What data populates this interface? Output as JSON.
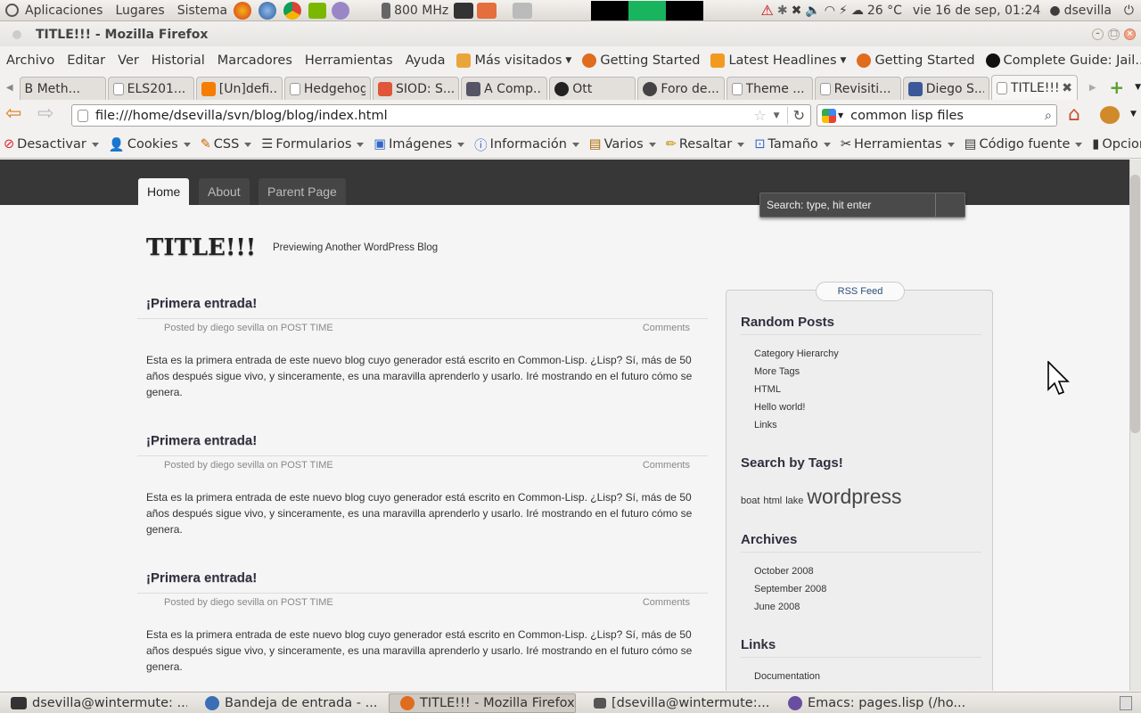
{
  "panel": {
    "menus": [
      "Aplicaciones",
      "Lugares",
      "Sistema"
    ],
    "cpu": "800 MHz",
    "temp": "26 °C",
    "clock": "vie 16 de sep, 01:24",
    "user": "dsevilla"
  },
  "window": {
    "title": "TITLE!!! - Mozilla Firefox"
  },
  "menubar": {
    "items": [
      "Archivo",
      "Editar",
      "Ver",
      "Historial",
      "Marcadores",
      "Herramientas",
      "Ayuda"
    ],
    "bookmarks": [
      "Más visitados",
      "Getting Started",
      "Latest Headlines",
      "Getting Started",
      "Complete Guide: Jail..."
    ]
  },
  "tabs": [
    "B Meth...",
    "ELS201...",
    "[Un]defi...",
    "Hedgehog",
    "SIOD: S...",
    "A Comp...",
    "Ott",
    "Foro de...",
    "Theme ...",
    "Revisiti...",
    "Diego S...",
    "TITLE!!!"
  ],
  "nav": {
    "url": "file:///home/dsevilla/svn/blog/blog/index.html",
    "search": "common lisp files"
  },
  "devbar": [
    "Desactivar",
    "Cookies",
    "CSS",
    "Formularios",
    "Imágenes",
    "Información",
    "Varios",
    "Resaltar",
    "Tamaño",
    "Herramientas",
    "Código fuente",
    "Opcion"
  ],
  "page": {
    "nav_tabs": [
      "Home",
      "About",
      "Parent Page"
    ],
    "search_placeholder": "Search: type, hit enter",
    "title": "TITLE!!!",
    "tagline": "Previewing Another WordPress Blog",
    "posts": [
      {
        "title": "¡Primera entrada!",
        "meta_posted": "Posted by diego sevilla on POST TIME",
        "meta_comments": "Comments",
        "body": "Esta es la primera entrada de este nuevo blog cuyo generador está escrito en Common-Lisp. ¿Lisp? Sí, más de 50 años después sigue vivo, y sinceramente, es una maravilla aprenderlo y usarlo. Iré mostrando en el futuro cómo se genera."
      },
      {
        "title": "¡Primera entrada!",
        "meta_posted": "Posted by diego sevilla on POST TIME",
        "meta_comments": "Comments",
        "body": "Esta es la primera entrada de este nuevo blog cuyo generador está escrito en Common-Lisp. ¿Lisp? Sí, más de 50 años después sigue vivo, y sinceramente, es una maravilla aprenderlo y usarlo. Iré mostrando en el futuro cómo se genera."
      },
      {
        "title": "¡Primera entrada!",
        "meta_posted": "Posted by diego sevilla on POST TIME",
        "meta_comments": "Comments",
        "body": "Esta es la primera entrada de este nuevo blog cuyo generador está escrito en Common-Lisp. ¿Lisp? Sí, más de 50 años después sigue vivo, y sinceramente, es una maravilla aprenderlo y usarlo. Iré mostrando en el futuro cómo se genera."
      }
    ],
    "sidebar": {
      "rss": "RSS Feed",
      "random_posts_title": "Random Posts",
      "random_posts": [
        "Category Hierarchy",
        "More Tags",
        "HTML",
        "Hello world!",
        "Links"
      ],
      "tags_title": "Search by Tags!",
      "tags": [
        "boat",
        "html",
        "lake",
        "wordpress"
      ],
      "archives_title": "Archives",
      "archives": [
        "October 2008",
        "September 2008",
        "June 2008"
      ],
      "links_title": "Links",
      "links": [
        "Documentation"
      ]
    }
  },
  "taskbar": [
    "dsevilla@wintermute: ...",
    "Bandeja de entrada - ...",
    "TITLE!!! - Mozilla Firefox",
    "[dsevilla@wintermute:...",
    "Emacs: pages.lisp (/ho..."
  ]
}
